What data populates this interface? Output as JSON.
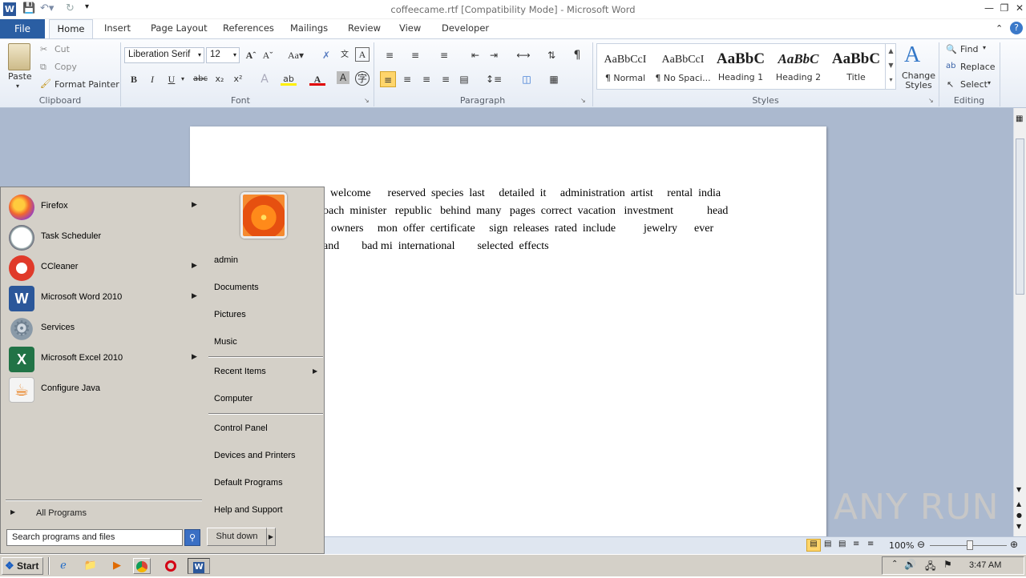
{
  "window": {
    "title": "coffeecame.rtf [Compatibility Mode]  -  Microsoft Word"
  },
  "tabs": {
    "file": "File",
    "items": [
      "Home",
      "Insert",
      "Page Layout",
      "References",
      "Mailings",
      "Review",
      "View",
      "Developer"
    ]
  },
  "clipboard": {
    "paste": "Paste",
    "cut": "Cut",
    "copy": "Copy",
    "format_painter": "Format Painter",
    "label": "Clipboard"
  },
  "font": {
    "family": "Liberation Serif",
    "size": "12",
    "label": "Font"
  },
  "paragraph": {
    "label": "Paragraph"
  },
  "styles": {
    "items": [
      {
        "sample": "AaBbCcI",
        "name": "¶ Normal"
      },
      {
        "sample": "AaBbCcI",
        "name": "¶ No Spaci..."
      },
      {
        "sample": "AaBbC",
        "name": "Heading 1"
      },
      {
        "sample": "AaBbC",
        "name": "Heading 2"
      },
      {
        "sample": "AaBbC",
        "name": "Title"
      }
    ],
    "change_styles": "Change Styles",
    "label": "Styles"
  },
  "editing": {
    "find": "Find",
    "replace": "Replace",
    "select": "Select",
    "label": "Editing"
  },
  "document": {
    "lines": [
      "welcome      reserved  species  last     detailed  it     administration  artist     rental  india",
      "oach  minister   republic   behind  many   pages  correct  vacation   investment            head",
      "owners     mon  offer  certificate     sign  releases  rated  include          jewelry      ever",
      "and        bad mi  international        selected  effects"
    ]
  },
  "statusbar": {
    "zoom": "100%"
  },
  "startmenu": {
    "programs": [
      {
        "label": "Firefox",
        "arrow": true
      },
      {
        "label": "Task Scheduler",
        "arrow": false
      },
      {
        "label": "CCleaner",
        "arrow": true
      },
      {
        "label": "Microsoft Word 2010",
        "arrow": true
      },
      {
        "label": "Services",
        "arrow": false
      },
      {
        "label": "Microsoft Excel 2010",
        "arrow": true
      },
      {
        "label": "Configure Java",
        "arrow": false
      }
    ],
    "all_programs": "All Programs",
    "search_placeholder": "Search programs and files",
    "right": {
      "user": "admin",
      "documents": "Documents",
      "pictures": "Pictures",
      "music": "Music",
      "recent_items": "Recent Items",
      "computer": "Computer",
      "control_panel": "Control Panel",
      "devices_printers": "Devices and Printers",
      "default_programs": "Default Programs",
      "help_support": "Help and Support"
    },
    "shutdown": "Shut down"
  },
  "taskbar": {
    "start": "Start",
    "clock": "3:47 AM"
  },
  "watermark": "ANY RUN"
}
